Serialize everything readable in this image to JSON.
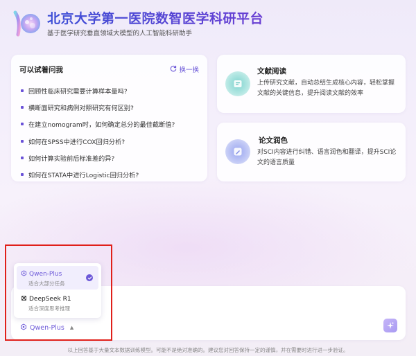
{
  "header": {
    "title": "北京大学第一医院数智医学科研平台",
    "subtitle": "基于医学研究垂直领域大模型的人工智能科研助手"
  },
  "suggestions": {
    "title": "可以试着问我",
    "refresh_label": "换一换",
    "items": [
      "回顾性临床研究需要计算样本量吗?",
      "横断面研究和病例对照研究有何区别?",
      "在建立nomogram时，如何确定总分的最佳截断值?",
      "如何在SPSS中进行COX回归分析?",
      "如何计算实验前后标准差的异?",
      "如何在STATA中进行Logistic回归分析?"
    ]
  },
  "features": [
    {
      "icon": "document-icon",
      "title": "文献阅读",
      "description": "上传研究文献，自动总结生成核心内容，轻松掌握文献的关键信息，提升阅读文献的效率"
    },
    {
      "icon": "pen-icon",
      "title": "论文润色",
      "description": "对SCI内容进行纠错、语言润色和翻译，提升SCI论文的语言质量"
    }
  ],
  "model_dropdown": {
    "options": [
      {
        "name": "Qwen-Plus",
        "description": "适合大部分任务",
        "selected": true
      },
      {
        "name": "DeepSeek R1",
        "description": "适合深度思考推理",
        "selected": false
      }
    ]
  },
  "input": {
    "selected_model": "Qwen-Plus"
  },
  "footer": {
    "disclaimer": "以上回答基于大量文本数据训练模型。可能不是绝对准确的。建议您对回答保持一定的谨慎，并在需要时进行进一步验证。"
  },
  "colors": {
    "accent": "#6c58d8",
    "title_gradient_start": "#3d4fd6",
    "title_gradient_end": "#6a3fd3",
    "highlight_border": "#e0201a"
  }
}
